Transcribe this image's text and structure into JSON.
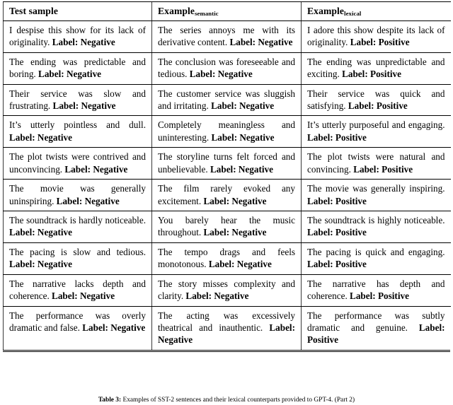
{
  "table": {
    "headers": [
      {
        "text": "Test sample",
        "subscript": ""
      },
      {
        "text": "Example",
        "subscript": "semantic"
      },
      {
        "text": "Example",
        "subscript": "lexical"
      }
    ],
    "rows": [
      {
        "test_sample": {
          "sentence": "I despise this show for its lack of originality.",
          "label": "Label: Negative"
        },
        "example_semantic": {
          "sentence": "The series annoys me with its derivative content.",
          "label": "Label: Negative"
        },
        "example_lexical": {
          "sentence": "I adore this show despite its lack of originality.",
          "label": "Label: Positive"
        }
      },
      {
        "test_sample": {
          "sentence": "The ending was predictable and boring.",
          "label": "Label: Negative"
        },
        "example_semantic": {
          "sentence": "The conclusion was foreseeable and tedious.",
          "label": "Label: Negative"
        },
        "example_lexical": {
          "sentence": "The ending was unpredictable and exciting.",
          "label": "Label: Positive"
        }
      },
      {
        "test_sample": {
          "sentence": "Their service was slow and frustrating.",
          "label": "Label: Negative"
        },
        "example_semantic": {
          "sentence": "The customer service was sluggish and irritating.",
          "label": "Label: Negative"
        },
        "example_lexical": {
          "sentence": "Their service was quick and satisfying.",
          "label": "Label: Positive"
        }
      },
      {
        "test_sample": {
          "sentence": "It’s utterly pointless and dull.",
          "label": "Label: Negative"
        },
        "example_semantic": {
          "sentence": "Completely meaningless and uninteresting.",
          "label": "Label: Negative"
        },
        "example_lexical": {
          "sentence": "It’s utterly purposeful and engaging.",
          "label": "Label: Positive"
        }
      },
      {
        "test_sample": {
          "sentence": "The plot twists were contrived and unconvincing.",
          "label": "Label: Negative"
        },
        "example_semantic": {
          "sentence": "The storyline turns felt forced and unbelievable.",
          "label": "Label: Negative"
        },
        "example_lexical": {
          "sentence": "The plot twists were natural and convincing.",
          "label": "Label: Positive"
        }
      },
      {
        "test_sample": {
          "sentence": "The movie was generally uninspiring.",
          "label": "Label: Negative"
        },
        "example_semantic": {
          "sentence": "The film rarely evoked any excitement.",
          "label": "Label: Negative"
        },
        "example_lexical": {
          "sentence": "The movie was generally inspiring.",
          "label": "Label: Positive"
        }
      },
      {
        "test_sample": {
          "sentence": "The soundtrack is hardly noticeable.",
          "label": "Label: Negative"
        },
        "example_semantic": {
          "sentence": "You barely hear the music throughout.",
          "label": "Label: Negative"
        },
        "example_lexical": {
          "sentence": "The soundtrack is highly noticeable.",
          "label": "Label: Positive"
        }
      },
      {
        "test_sample": {
          "sentence": "The pacing is slow and tedious.",
          "label": "Label: Negative"
        },
        "example_semantic": {
          "sentence": "The tempo drags and feels monotonous.",
          "label": "Label: Negative"
        },
        "example_lexical": {
          "sentence": "The pacing is quick and engaging.",
          "label": "Label: Positive"
        }
      },
      {
        "test_sample": {
          "sentence": "The narrative lacks depth and coherence.",
          "label": "Label: Negative"
        },
        "example_semantic": {
          "sentence": "The story misses complexity and clarity.",
          "label": "Label: Negative"
        },
        "example_lexical": {
          "sentence": "The narrative has depth and coherence.",
          "label": "Label: Positive"
        }
      },
      {
        "test_sample": {
          "sentence": "The performance was overly dramatic and false.",
          "label": "Label: Negative"
        },
        "example_semantic": {
          "sentence": "The acting was excessively theatrical and inauthentic.",
          "label": "Label: Negative"
        },
        "example_lexical": {
          "sentence": "The performance was subtly dramatic and genuine.",
          "label": "Label: Positive"
        }
      }
    ]
  },
  "caption": {
    "label": "Table 3:",
    "text": "Examples of SST-2 sentences and their lexical counterparts provided to GPT-4. (Part 2)"
  }
}
